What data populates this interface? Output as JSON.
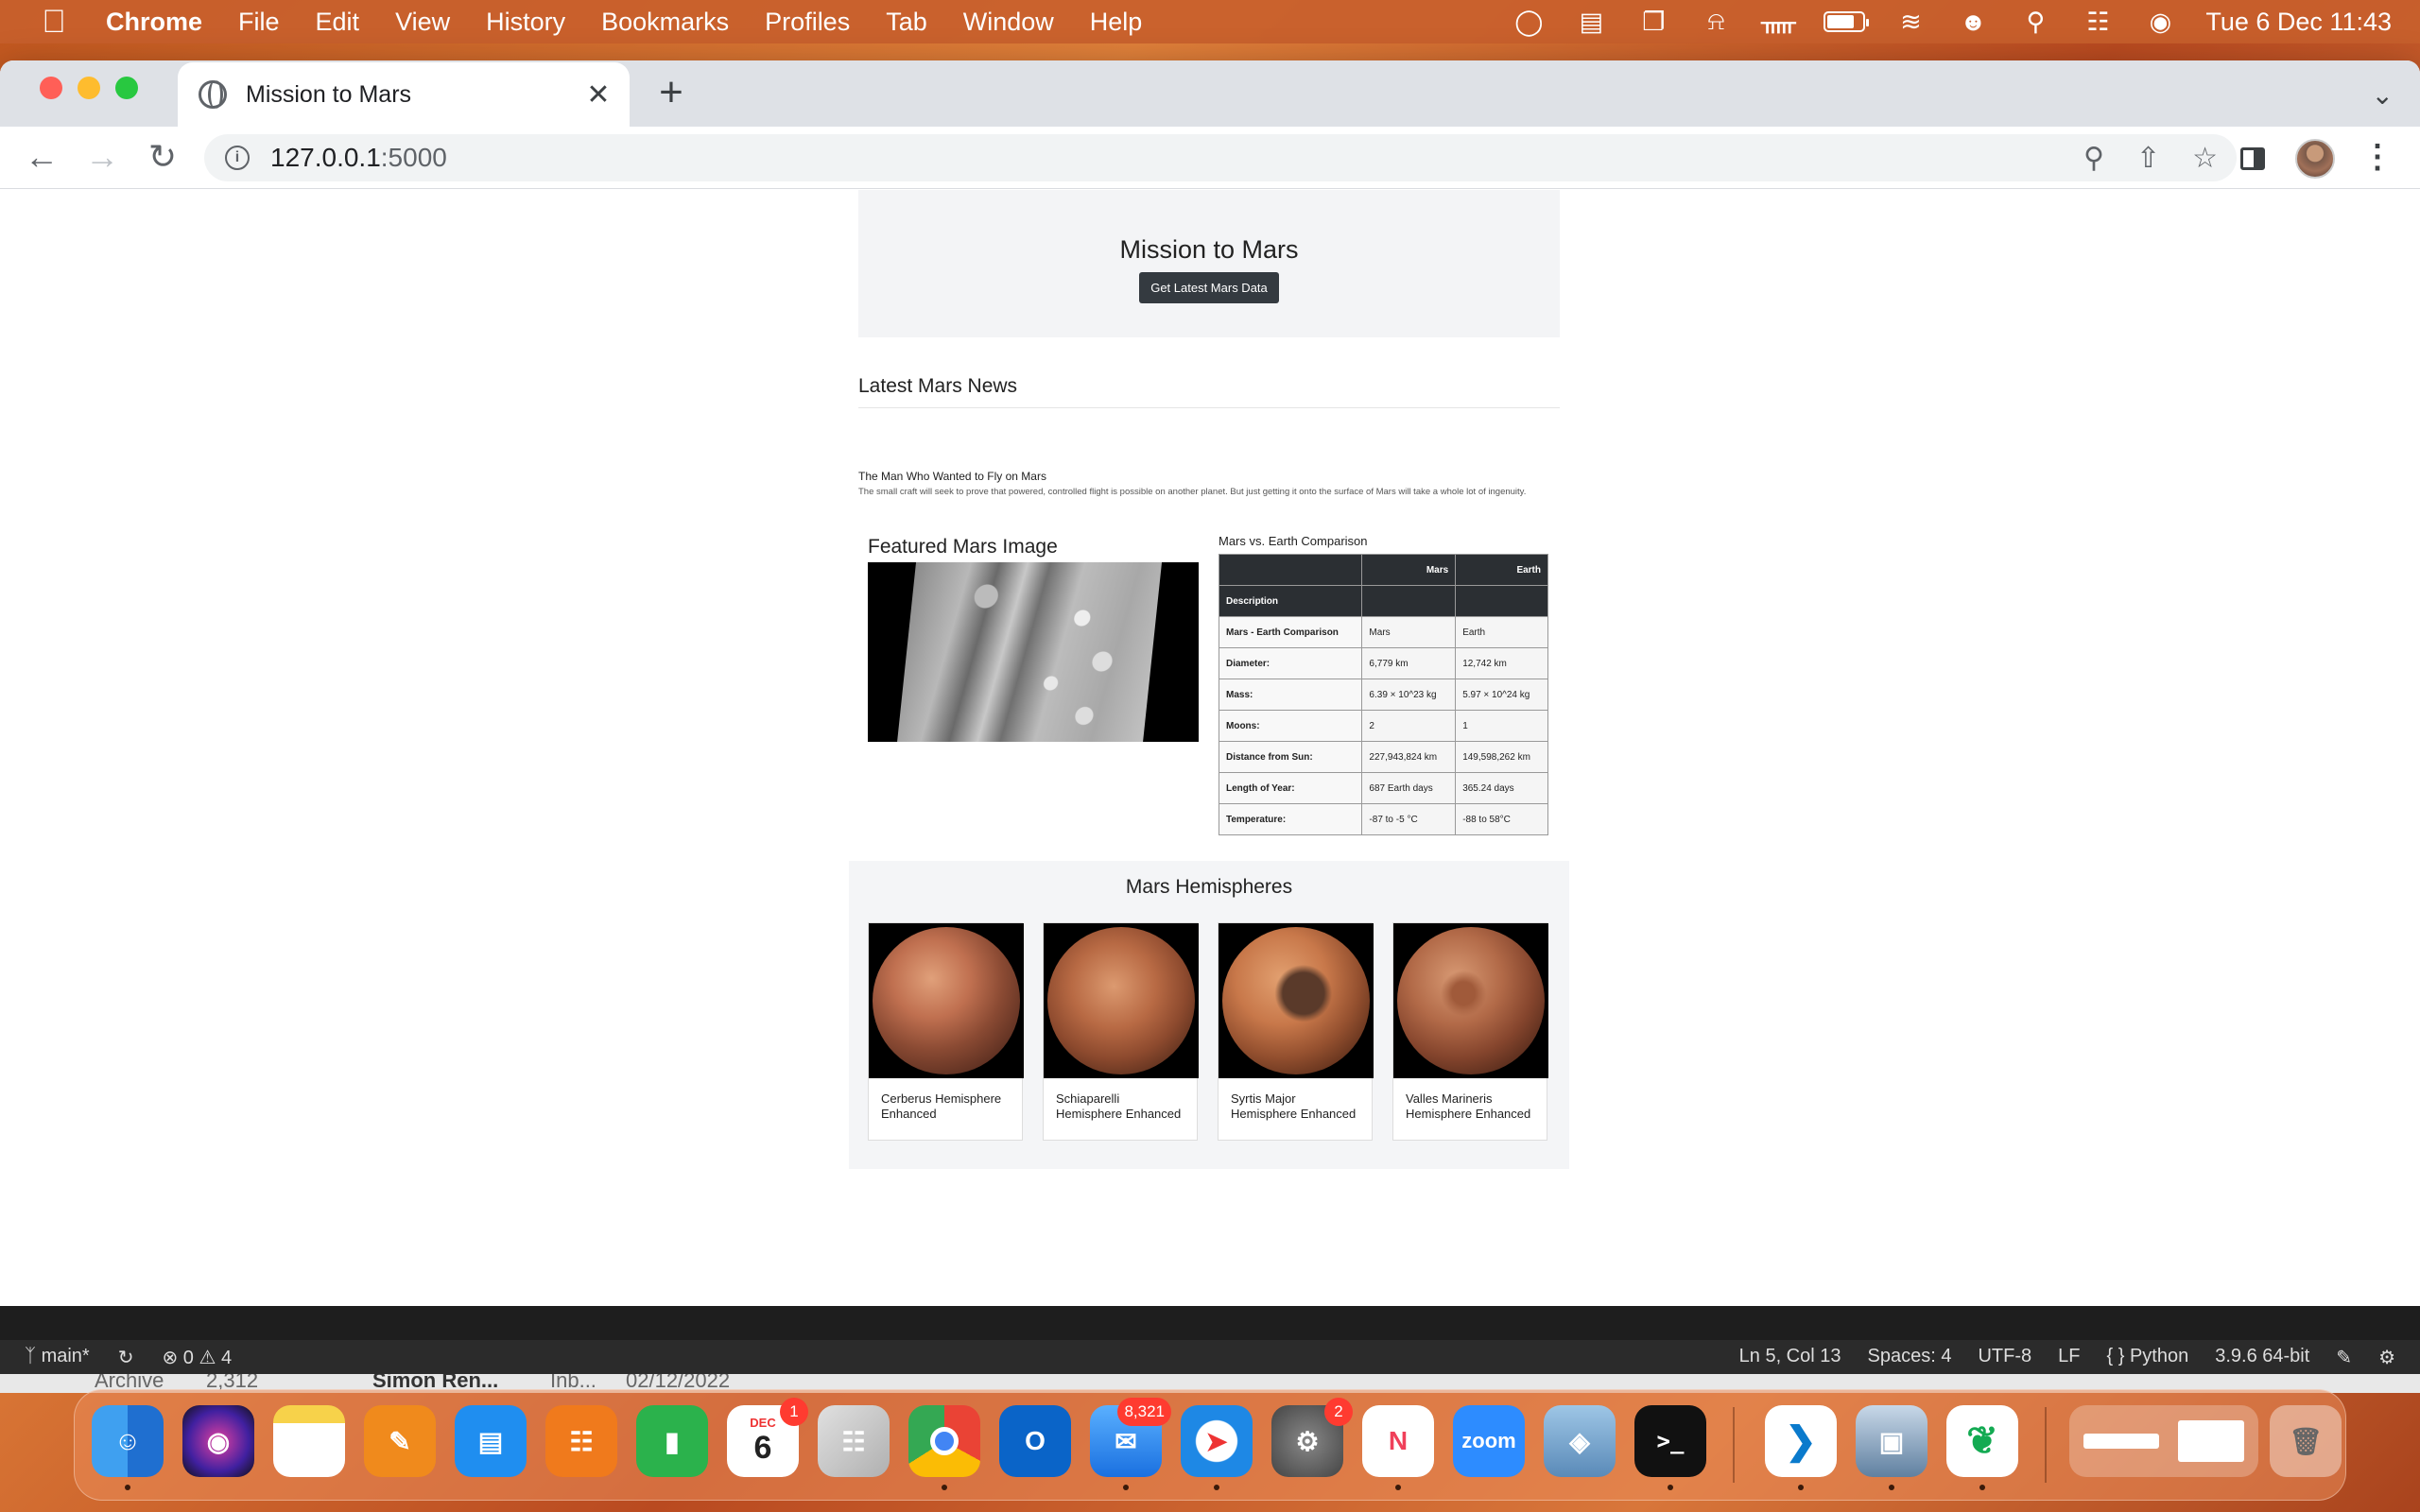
{
  "menubar": {
    "app_name": "Chrome",
    "menus": [
      "File",
      "Edit",
      "View",
      "History",
      "Bookmarks",
      "Profiles",
      "Tab",
      "Window",
      "Help"
    ],
    "clock": "Tue 6 Dec  11:43"
  },
  "browser": {
    "tab_title": "Mission to Mars",
    "url_host": "127.0.0.1",
    "url_port": ":5000"
  },
  "page": {
    "title": "Mission to Mars",
    "scrape_button": "Get Latest Mars Data",
    "news": {
      "heading": "Latest Mars News",
      "title": "The Man Who Wanted to Fly on Mars",
      "paragraph": "The small craft will seek to prove that powered, controlled flight is possible on another planet. But just getting it onto the surface of Mars will take a whole lot of ingenuity."
    },
    "featured": {
      "heading": "Featured Mars Image"
    },
    "facts": {
      "caption": "Mars vs. Earth Comparison",
      "header_cols": [
        "",
        "Mars",
        "Earth"
      ],
      "index_label": "Description",
      "rows": [
        [
          "Mars - Earth Comparison",
          "Mars",
          "Earth"
        ],
        [
          "Diameter:",
          "6,779 km",
          "12,742 km"
        ],
        [
          "Mass:",
          "6.39 × 10^23 kg",
          "5.97 × 10^24 kg"
        ],
        [
          "Moons:",
          "2",
          "1"
        ],
        [
          "Distance from Sun:",
          "227,943,824 km",
          "149,598,262 km"
        ],
        [
          "Length of Year:",
          "687 Earth days",
          "365.24 days"
        ],
        [
          "Temperature:",
          "-87 to -5 °C",
          "-88 to 58°C"
        ]
      ]
    },
    "hemispheres": {
      "heading": "Mars Hemispheres",
      "items": [
        "Cerberus Hemisphere Enhanced",
        "Schiaparelli Hemisphere Enhanced",
        "Syrtis Major Hemisphere Enhanced",
        "Valles Marineris Hemisphere Enhanced"
      ]
    }
  },
  "vscode": {
    "branch": "main*",
    "errors": "0",
    "warnings": "4",
    "cursor": "Ln 5, Col 13",
    "spaces": "Spaces: 4",
    "encoding": "UTF-8",
    "eol": "LF",
    "language": "Python",
    "interpreter": "3.9.6 64-bit",
    "behind": {
      "a": "Archive",
      "b": "2,312",
      "c": "Simon Ren...",
      "d": "Inb...",
      "e": "02/12/2022"
    }
  },
  "dock": {
    "calendar_month": "DEC",
    "calendar_day": "6",
    "calendar_badge": "1",
    "mail_badge": "8,321",
    "settings_badge": "2",
    "zoom_label": "zoom"
  }
}
